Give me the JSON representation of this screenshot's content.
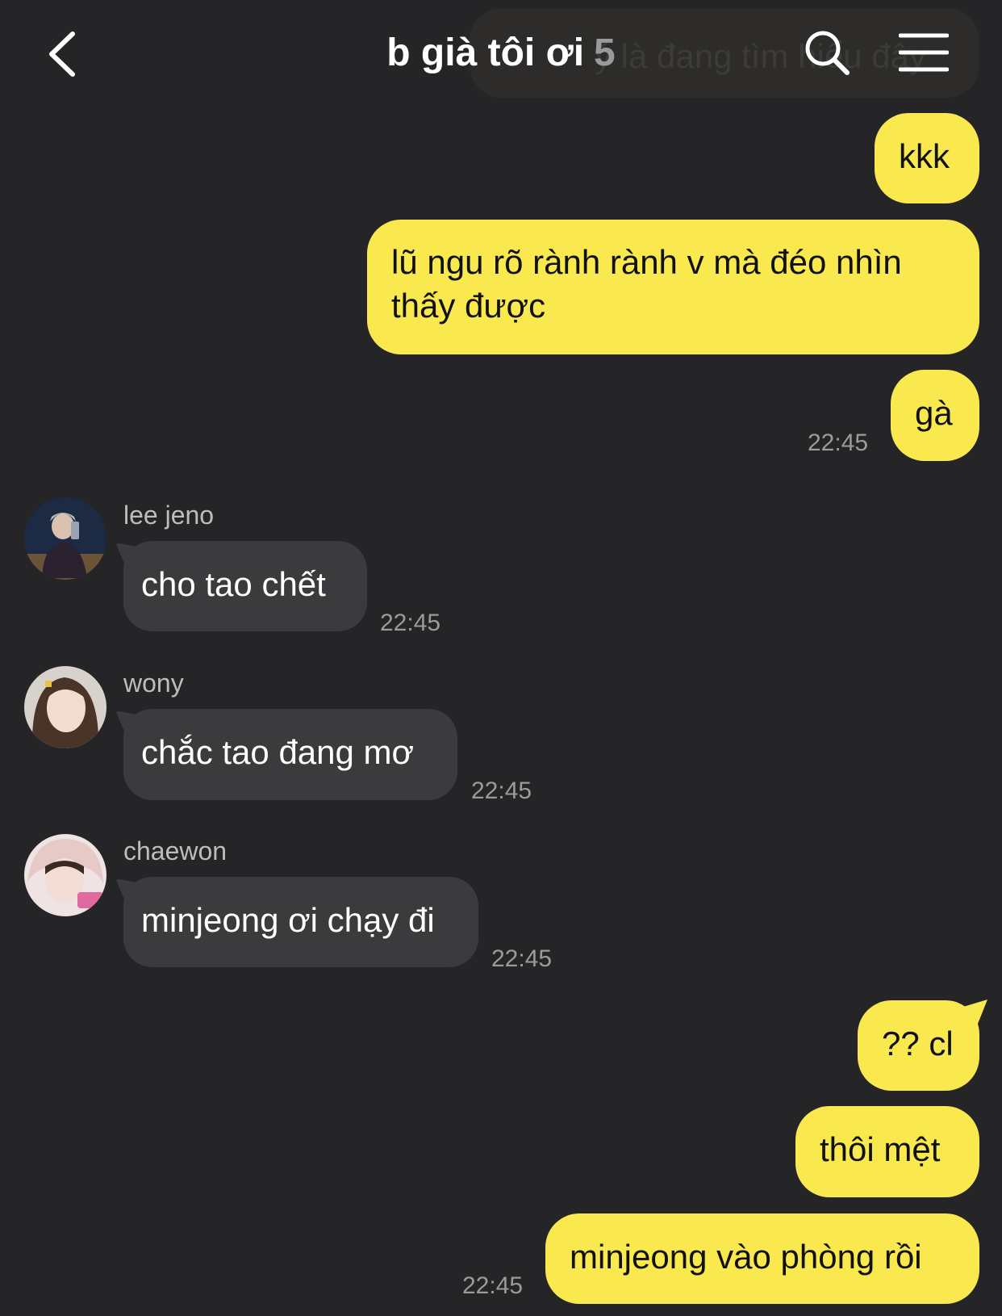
{
  "header": {
    "title": "b già tôi ơi",
    "member_count": "5",
    "ghost_text": "ý là đang tìm hiểu đây"
  },
  "colors": {
    "background": "#252528",
    "my_bubble": "#fae84f",
    "their_bubble": "#3b3b3e"
  },
  "messages": {
    "m1": "kkk",
    "m2_line1": "lũ ngu rõ rành rành v mà đéo nhìn",
    "m2_line2": "thấy được",
    "m3": "gà",
    "m3_time": "22:45",
    "jeno_name": "lee jeno",
    "jeno_msg": "cho tao chết",
    "jeno_time": "22:45",
    "wony_name": "wony",
    "wony_msg": "chắc tao đang mơ",
    "wony_time": "22:45",
    "chaewon_name": "chaewon",
    "chaewon_msg": "minjeong ơi chạy đi",
    "chaewon_time": "22:45",
    "m4": "?? cl",
    "m5": "thôi mệt",
    "m6": "minjeong vào phòng rồi",
    "m6_time": "22:45"
  }
}
